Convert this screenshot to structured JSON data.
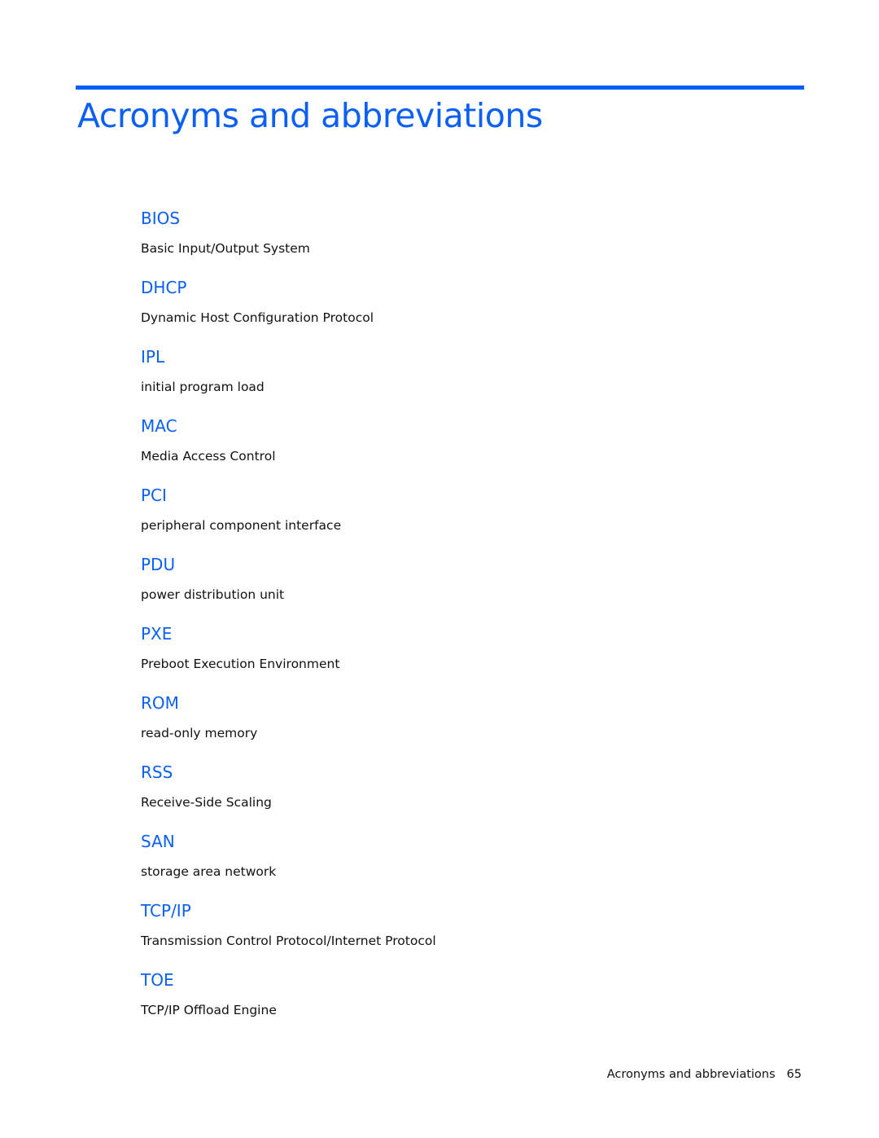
{
  "page": {
    "title": "Acronyms and abbreviations",
    "accent_color": "#0a5ff5"
  },
  "entries": [
    {
      "term": "BIOS",
      "definition": "Basic Input/Output System"
    },
    {
      "term": "DHCP",
      "definition": "Dynamic Host Configuration Protocol"
    },
    {
      "term": "IPL",
      "definition": "initial program load"
    },
    {
      "term": "MAC",
      "definition": "Media Access Control"
    },
    {
      "term": "PCI",
      "definition": "peripheral component interface"
    },
    {
      "term": "PDU",
      "definition": "power distribution unit"
    },
    {
      "term": "PXE",
      "definition": "Preboot Execution Environment"
    },
    {
      "term": "ROM",
      "definition": "read-only memory"
    },
    {
      "term": "RSS",
      "definition": "Receive-Side Scaling"
    },
    {
      "term": "SAN",
      "definition": "storage area network"
    },
    {
      "term": "TCP/IP",
      "definition": "Transmission Control Protocol/Internet Protocol"
    },
    {
      "term": "TOE",
      "definition": "TCP/IP Offload Engine"
    }
  ],
  "footer": {
    "section": "Acronyms and abbreviations",
    "page_number": "65"
  }
}
